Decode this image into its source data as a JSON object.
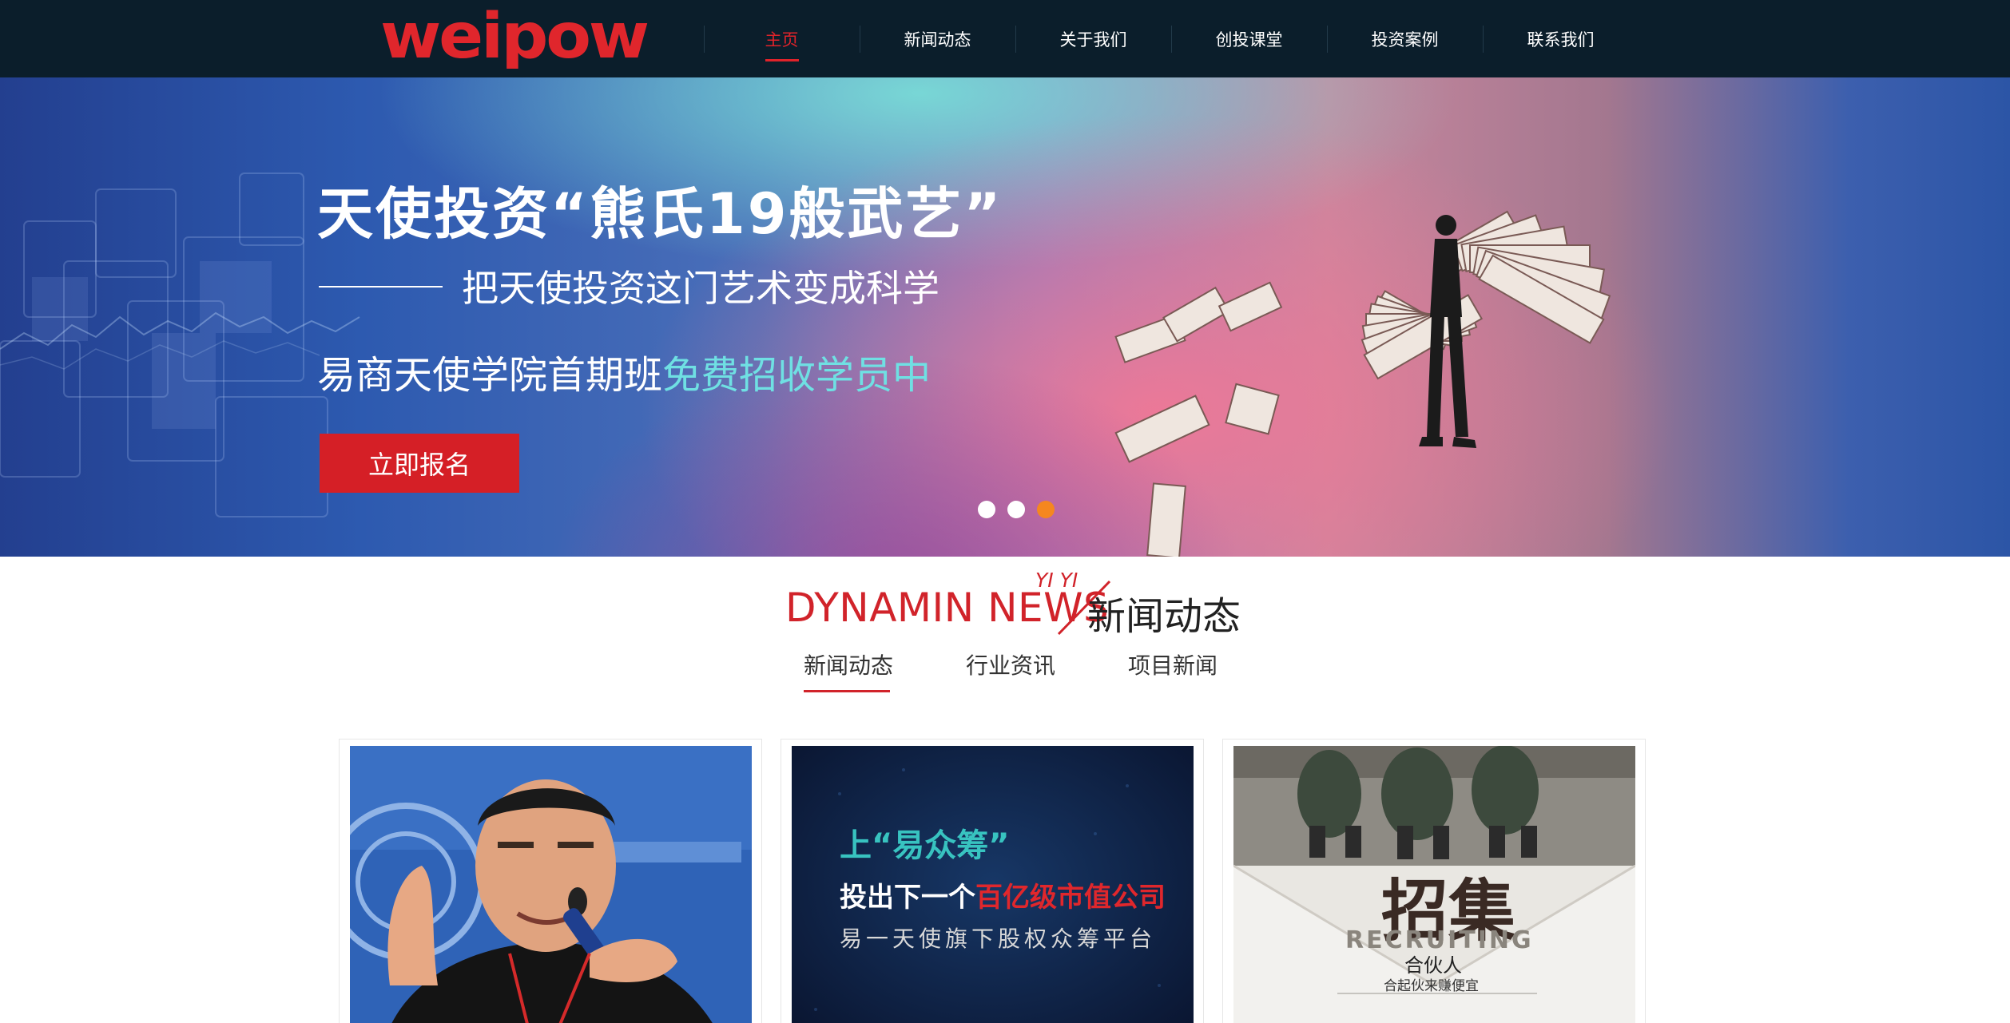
{
  "header": {
    "logo_text": "weipow",
    "nav": [
      {
        "label": "主页",
        "active": true
      },
      {
        "label": "新闻动态",
        "active": false
      },
      {
        "label": "关于我们",
        "active": false
      },
      {
        "label": "创投课堂",
        "active": false
      },
      {
        "label": "投资案例",
        "active": false
      },
      {
        "label": "联系我们",
        "active": false
      }
    ]
  },
  "banner": {
    "title": "天使投资“熊氏19般武艺”",
    "subtitle": "把天使投资这门艺术变成科学",
    "line3_prefix": "易商天使学院首期班",
    "line3_highlight": "免费招收学员中",
    "cta_label": "立即报名",
    "slides": 3,
    "active_slide": 3,
    "highlight_color": "#6fe0e3"
  },
  "news": {
    "title_en": "DYNAMIN NEWS",
    "title_small": "YI YI",
    "title_cn": "新闻动态",
    "tabs": [
      "新闻动态",
      "行业资讯",
      "项目新闻"
    ],
    "active_tab": 0,
    "cards": [
      {
        "image": "speaker-photo"
      },
      {
        "image": "crowdfunding-poster",
        "line1": "上“易众筹”",
        "line2_prefix": "投出下一个",
        "line2_highlight": "百亿级市值公司",
        "line3": "易一天使旗下股权众筹平台"
      },
      {
        "image": "recruiting-poster",
        "big_text": "招集",
        "en_text": "RECRUITING",
        "sub_text": "合伙人",
        "small_text": "合起伙来赚便宜"
      }
    ]
  },
  "colors": {
    "header_bg": "#0b1e2b",
    "accent_red": "#d1232a",
    "dot_active": "#f5871f"
  }
}
